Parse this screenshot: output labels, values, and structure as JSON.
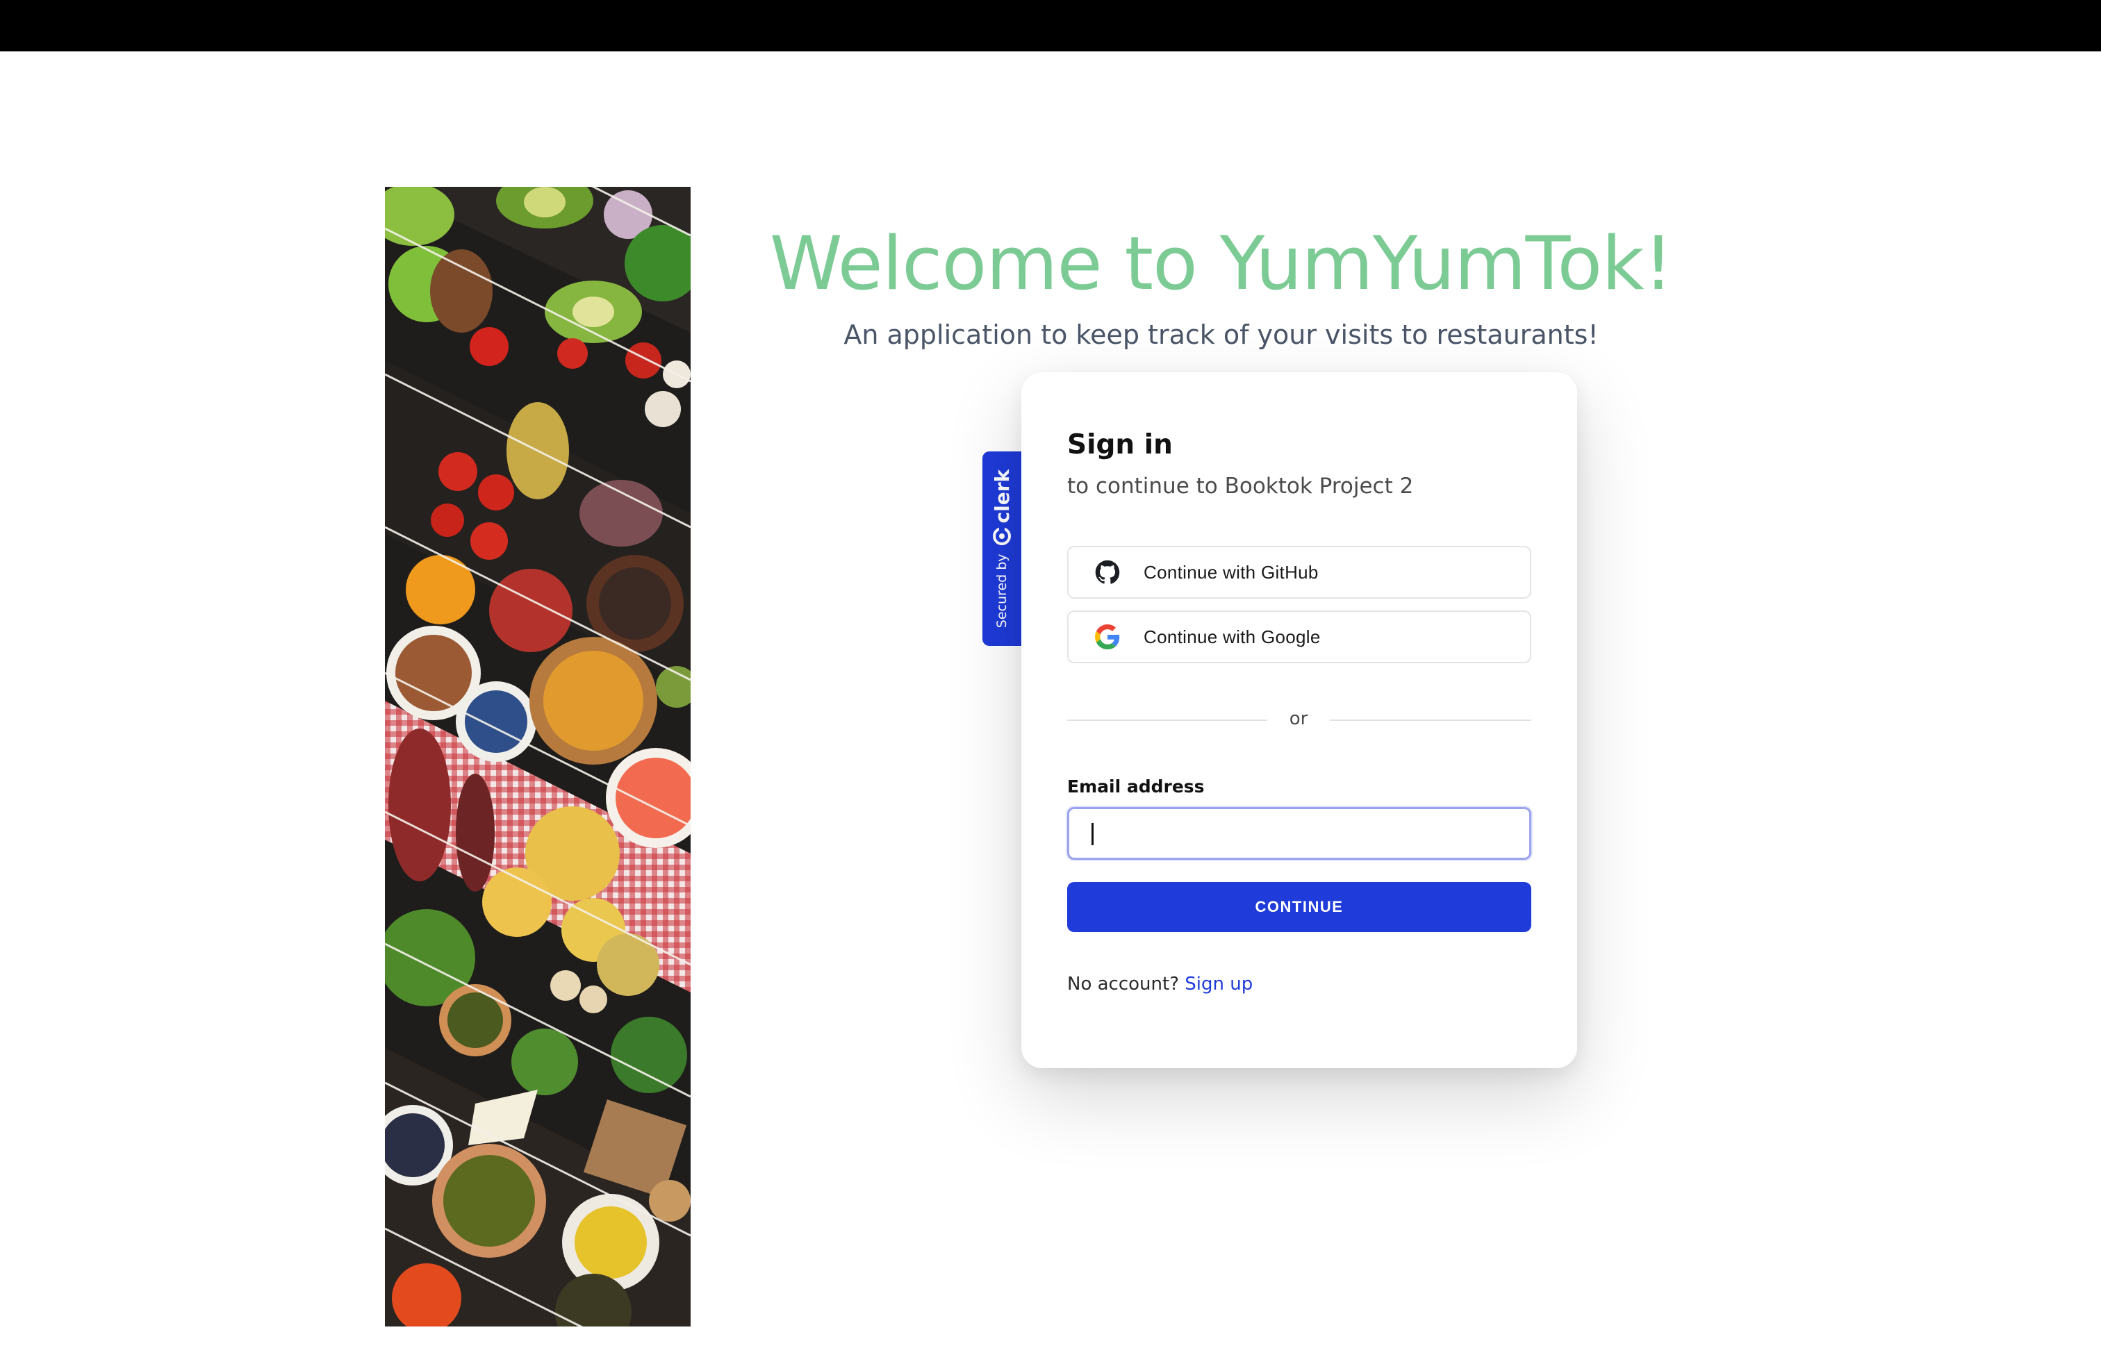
{
  "colors": {
    "brand_title": "#7ccb95",
    "accent_blue": "#1f3bd9",
    "subtitle_gray": "#4a5568",
    "top_bar": "#000000"
  },
  "hero": {
    "title": "Welcome to YumYumTok!",
    "subtitle": "An application to keep track of your visits to restaurants!"
  },
  "collage": {
    "icon": "food-collage-image"
  },
  "secured_badge": {
    "label": "Secured by",
    "brand": "clerk",
    "icon": "clerk-logo-icon"
  },
  "sign_in": {
    "title": "Sign in",
    "subtitle": "to continue to Booktok Project 2",
    "social": [
      {
        "label": "Continue with GitHub",
        "icon": "github-icon"
      },
      {
        "label": "Continue with Google",
        "icon": "google-icon"
      }
    ],
    "divider_text": "or",
    "email": {
      "label": "Email address",
      "value": "",
      "placeholder": ""
    },
    "continue_label": "CONTINUE",
    "no_account_text": "No account?",
    "signup_link": "Sign up"
  }
}
